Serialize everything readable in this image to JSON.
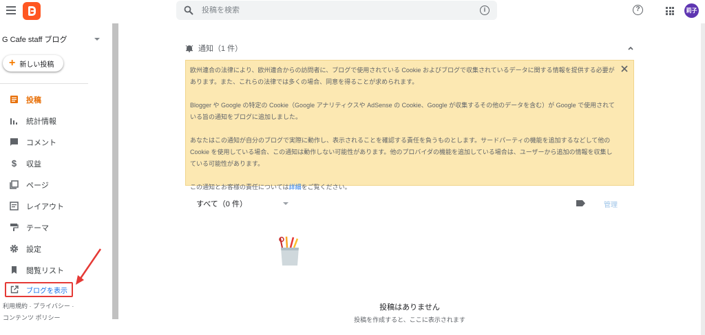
{
  "search": {
    "placeholder": "投稿を検索"
  },
  "header": {
    "help_label": "?",
    "avatar_text": "莉子"
  },
  "sidebar": {
    "blog_name": "G Cafe staff ブログ",
    "new_post_label": "新しい投稿",
    "items": [
      {
        "label": "投稿",
        "icon": "posts-icon",
        "active": true
      },
      {
        "label": "統計情報",
        "icon": "stats-icon"
      },
      {
        "label": "コメント",
        "icon": "comment-icon"
      },
      {
        "label": "収益",
        "icon": "dollar-icon"
      },
      {
        "label": "ページ",
        "icon": "pages-icon"
      },
      {
        "label": "レイアウト",
        "icon": "layout-icon"
      },
      {
        "label": "テーマ",
        "icon": "theme-roller-icon"
      },
      {
        "label": "設定",
        "icon": "gear-icon"
      },
      {
        "label": "閲覧リスト",
        "icon": "bookmark-icon"
      }
    ],
    "view_blog_label": "ブログを表示",
    "footer": {
      "terms": "利用規約",
      "sep1": " · ",
      "privacy": "プライバシー",
      "sep2": " ·",
      "content_policy": "コンテンツ ポリシー"
    }
  },
  "notice": {
    "title": "通知（1 件）",
    "paragraph1": "欧州連合の法律により、欧州連合からの訪問者に、ブログで使用されている Cookie およびブログで収集されているデータに関する情報を提供する必要があります。また、これらの法律では多くの場合、同意を得ることが求められます。",
    "paragraph2": "Blogger や Google の特定の Cookie（Google アナリティクスや AdSense の Cookie、Google が収集するその他のデータを含む）が Google で使用されている旨の通知をブログに追加しました。",
    "paragraph3": "あなたはこの通知が自分のブログで実際に動作し、表示されることを確認する責任を負うものとします。サードパーティの機能を追加するなどして他の Cookie を使用している場合、この通知は動作しない可能性があります。他のプロバイダの機能を追加している場合は、ユーザーから追加の情報を収集している可能性があります。",
    "paragraph4_before": "この通知とお客様の責任については",
    "paragraph4_link": "詳細",
    "paragraph4_after": "をご覧ください。"
  },
  "posts": {
    "filter_label": "すべて（0 件）",
    "manage_label": "管理",
    "empty_title": "投稿はありません",
    "empty_subtitle": "投稿を作成すると、ここに表示されます"
  },
  "colors": {
    "accent": "#e8710a",
    "brand": "#ff5722",
    "notice_bg": "#fce8b2",
    "highlight_red": "#e53935",
    "link": "#1a73e8"
  }
}
